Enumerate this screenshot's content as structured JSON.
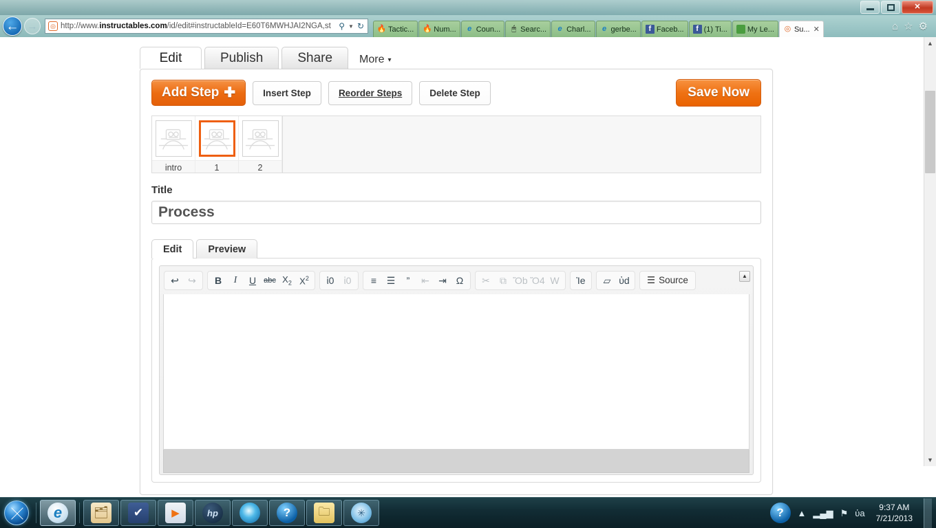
{
  "desktop": {
    "icon_name": "fingerprint-password-manager"
  },
  "window": {
    "minimize_label": "–",
    "maximize_label": "❐",
    "close_label": "✕"
  },
  "browser": {
    "back_label": "←",
    "forward_label": "→",
    "address": {
      "security_icon": "site-identity-icon",
      "url_prefix": "http://www.",
      "url_domain": "instructables.com",
      "url_suffix": "/id/edit#instructableId=E60T6MWHJAI2NGA,st",
      "search_icon": "⚲",
      "caret": "▼",
      "refresh_icon": "↻"
    },
    "tabs": [
      {
        "label": "Tactic...",
        "favicon": "flame-icon",
        "active": false
      },
      {
        "label": "Num...",
        "favicon": "flame-icon",
        "active": false
      },
      {
        "label": "Coun...",
        "favicon": "ie-icon",
        "active": false
      },
      {
        "label": "Searc...",
        "favicon": "mouse-icon",
        "active": false
      },
      {
        "label": "Charl...",
        "favicon": "ie-icon",
        "active": false
      },
      {
        "label": "gerbe...",
        "favicon": "ie-icon",
        "active": false
      },
      {
        "label": "Faceb...",
        "favicon": "facebook-icon",
        "active": false
      },
      {
        "label": "(1) Ti...",
        "favicon": "facebook-icon",
        "active": false
      },
      {
        "label": "My Le...",
        "favicon": "green-square-icon",
        "active": false
      },
      {
        "label": "Su...",
        "favicon": "instructables-icon",
        "active": true,
        "close_label": "✕"
      }
    ],
    "tools": {
      "home": "⌂",
      "favorites": "☆",
      "settings": "⚙"
    }
  },
  "app": {
    "tabs": [
      {
        "label": "Edit",
        "active": true
      },
      {
        "label": "Publish",
        "active": false
      },
      {
        "label": "Share",
        "active": false
      }
    ],
    "more_label": "More",
    "more_caret": "▾",
    "step_toolbar": {
      "add_step_label": "Add Step",
      "add_step_plus": "✚",
      "insert_step_label": "Insert Step",
      "reorder_steps_label": "Reorder Steps",
      "delete_step_label": "Delete Step",
      "save_now_label": "Save Now"
    },
    "steps": [
      {
        "label": "intro",
        "selected": false
      },
      {
        "label": "1",
        "selected": true
      },
      {
        "label": "2",
        "selected": false
      }
    ],
    "title_field": {
      "label": "Title",
      "value": "Process",
      "placeholder": "Title"
    },
    "editor_tabs": [
      {
        "label": "Edit",
        "active": true
      },
      {
        "label": "Preview",
        "active": false
      }
    ],
    "editor": {
      "body_text": "",
      "collapse_toolbar_label": "▲",
      "toolbar_groups": [
        {
          "name": "history",
          "buttons": [
            {
              "name": "undo-icon",
              "glyph": "↩",
              "dim": false
            },
            {
              "name": "redo-icon",
              "glyph": "↪",
              "dim": true
            }
          ]
        },
        {
          "name": "basic-styles",
          "buttons": [
            {
              "name": "bold-icon",
              "glyph": "B",
              "style": "bold",
              "dim": false
            },
            {
              "name": "italic-icon",
              "glyph": "I",
              "style": "italic",
              "dim": false
            },
            {
              "name": "underline-icon",
              "glyph": "U",
              "style": "underline",
              "dim": false
            },
            {
              "name": "strikethrough-icon",
              "glyph": "abc",
              "style": "strike",
              "dim": false
            },
            {
              "name": "subscript-icon",
              "glyph": "X",
              "style": "sub",
              "dim": false
            },
            {
              "name": "superscript-icon",
              "glyph": "X",
              "style": "sup",
              "dim": false
            }
          ]
        },
        {
          "name": "links",
          "buttons": [
            {
              "name": "link-icon",
              "glyph": "ἱ0",
              "dim": false
            },
            {
              "name": "unlink-icon",
              "glyph": "ἱ0",
              "dim": true
            }
          ]
        },
        {
          "name": "paragraph",
          "buttons": [
            {
              "name": "numbered-list-icon",
              "glyph": "≡",
              "dim": false
            },
            {
              "name": "bulleted-list-icon",
              "glyph": "☰",
              "dim": false
            },
            {
              "name": "blockquote-icon",
              "glyph": "”",
              "dim": false
            },
            {
              "name": "outdent-icon",
              "glyph": "⇤",
              "dim": true
            },
            {
              "name": "indent-icon",
              "glyph": "⇥",
              "dim": false
            },
            {
              "name": "special-character-icon",
              "glyph": "Ω",
              "dim": false
            }
          ]
        },
        {
          "name": "clipboard",
          "buttons": [
            {
              "name": "cut-icon",
              "glyph": "✂",
              "dim": true
            },
            {
              "name": "copy-icon",
              "glyph": "⧉",
              "dim": true
            },
            {
              "name": "paste-icon",
              "glyph": "Ὄb",
              "dim": true
            },
            {
              "name": "paste-as-plain-text-icon",
              "glyph": "Ὄ4",
              "dim": true
            },
            {
              "name": "paste-from-word-icon",
              "glyph": "W",
              "dim": true
            }
          ]
        },
        {
          "name": "insert",
          "buttons": [
            {
              "name": "image-video-icon",
              "glyph": "Ἱe",
              "dim": false
            }
          ]
        },
        {
          "name": "tools",
          "buttons": [
            {
              "name": "remove-format-icon",
              "glyph": "▱",
              "dim": false
            },
            {
              "name": "find-replace-icon",
              "glyph": "ὐd",
              "dim": false
            }
          ]
        },
        {
          "name": "source",
          "buttons": [
            {
              "name": "source-icon",
              "glyph": "☰",
              "label": "Source",
              "dim": false
            }
          ]
        }
      ]
    }
  },
  "scrollbar": {
    "up_arrow": "▲",
    "down_arrow": "▼"
  },
  "taskbar": {
    "start_label": "Start",
    "items": [
      {
        "name": "internet-explorer",
        "icon": "ie-icon",
        "state": "pinned-active"
      },
      {
        "name": "windows-explorer",
        "icon": "explorer-icon",
        "state": "running"
      },
      {
        "name": "check-app",
        "icon": "check-icon",
        "state": "running"
      },
      {
        "name": "media-player",
        "icon": "play-icon",
        "state": "running"
      },
      {
        "name": "hp-app",
        "icon": "hp-icon",
        "state": "running"
      },
      {
        "name": "orb-app",
        "icon": "orb-icon",
        "state": "running"
      },
      {
        "name": "help-app",
        "icon": "help-icon",
        "state": "running"
      },
      {
        "name": "folder-app",
        "icon": "folder-icon",
        "state": "running"
      },
      {
        "name": "fan-app",
        "icon": "fan-icon",
        "state": "running"
      }
    ],
    "tray": {
      "action_center_icon": "help-icon",
      "show_hidden_icon": "▲",
      "network_icon": "▂▄▆",
      "flag_icon": "⚑",
      "volume_icon": "ὐa",
      "time": "9:37 AM",
      "date": "7/21/2013"
    }
  }
}
